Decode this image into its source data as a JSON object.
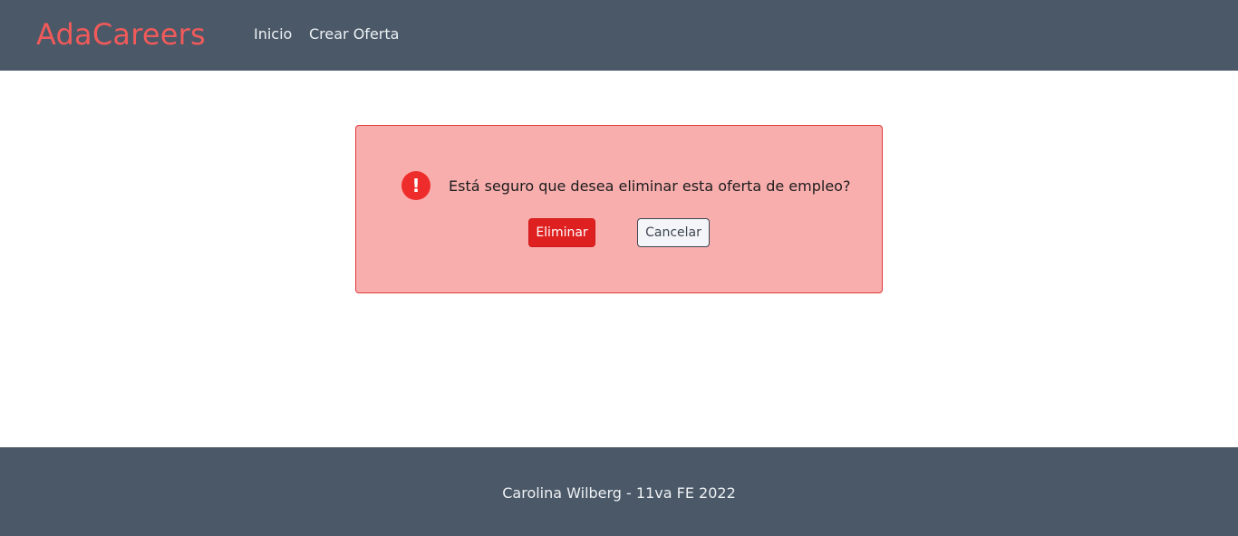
{
  "header": {
    "brand": "AdaCareers",
    "nav": {
      "home": "Inicio",
      "create_offer": "Crear Oferta"
    }
  },
  "dialog": {
    "icon": "exclamation-circle-icon",
    "icon_glyph": "!",
    "message": "Está seguro que desea eliminar esta oferta de empleo?",
    "delete_label": "Eliminar",
    "cancel_label": "Cancelar"
  },
  "footer": {
    "text": "Carolina Wilberg - 11va FE 2022"
  },
  "colors": {
    "navbar": "#4a5867",
    "brand": "#f05a5a",
    "dialog_bg": "#f9aeae",
    "dialog_border": "#e03a3a",
    "danger": "#df2020"
  }
}
